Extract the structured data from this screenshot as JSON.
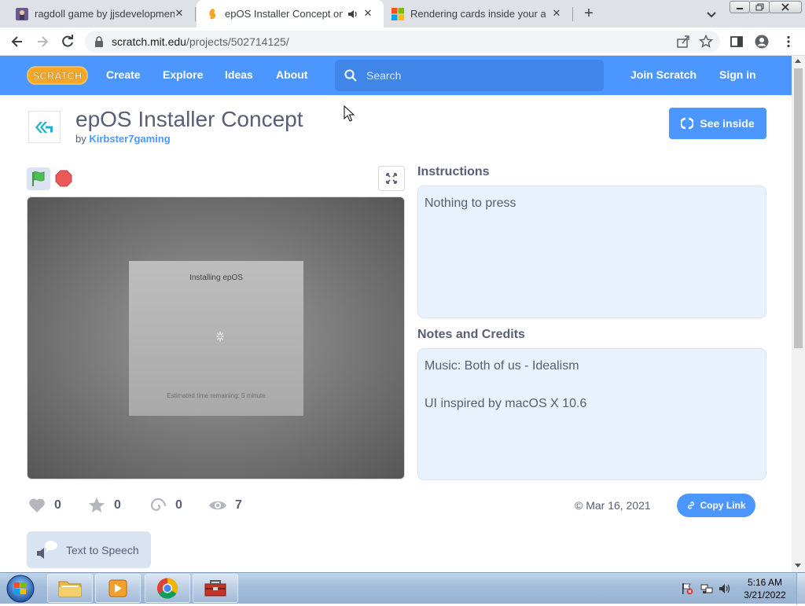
{
  "browser": {
    "tabs": [
      {
        "title": "ragdoll game by jjsdevelopments",
        "icon": "ragdoll-favicon-icon",
        "active": false
      },
      {
        "title": "epOS Installer Concept on Scratch",
        "icon": "scratch-favicon-icon",
        "active": true
      },
      {
        "title": "Rendering cards inside your app",
        "icon": "microsoft-favicon-icon",
        "active": false
      }
    ],
    "new_tab_label": "+",
    "url_host": "scratch.mit.edu",
    "url_path": "/projects/502714125/"
  },
  "scratch_nav": {
    "logo_text": "SCRATCH",
    "links": [
      "Create",
      "Explore",
      "Ideas",
      "About"
    ],
    "search_placeholder": "Search",
    "join": "Join Scratch",
    "signin": "Sign in"
  },
  "project": {
    "title": "epOS Installer Concept",
    "by_label": "by",
    "author": "Kirbster7gaming",
    "see_inside": "See inside",
    "stage": {
      "dialog_title": "Installing epOS",
      "estimate": "Estimated time remaining: 5 minute"
    },
    "stats": {
      "loves": "0",
      "favorites": "0",
      "remixes": "0",
      "views": "7"
    },
    "shared_date": "© Mar 16, 2021",
    "copy_link": "Copy Link",
    "tts_label": "Text to Speech",
    "instructions_heading": "Instructions",
    "instructions": "Nothing to press",
    "notes_heading": "Notes and Credits",
    "notes": [
      "Music: Both of us - Idealism",
      "",
      "UI inspired by macOS X 10.6"
    ]
  },
  "taskbar": {
    "time": "5:16 AM",
    "date": "3/21/2022"
  },
  "colors": {
    "scratch_blue": "#4c97ff",
    "scratch_text": "#575e75",
    "notes_bg": "#e9f1fc"
  }
}
